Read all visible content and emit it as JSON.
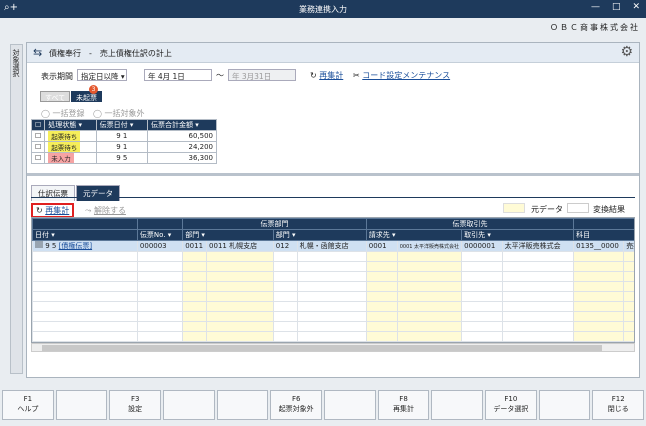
{
  "window": {
    "title": "業務連携入力",
    "company": "ＯＢＣ商事株式会社"
  },
  "side_tab": "対象選択",
  "header": {
    "title": "債権奉行　-　売上債権仕訳の計上"
  },
  "filter": {
    "label": "表示期間",
    "mode": "指定日以降",
    "date_from": "年  4月  1日",
    "tilde": "～",
    "date_to": "年  3月31日",
    "recalc": "再集計",
    "code_settings": "コード設定メンテナンス"
  },
  "status_buttons": {
    "all": "すべて",
    "unstarted": "未起票",
    "count": "3"
  },
  "options": {
    "batch": "一括登録",
    "batch_exclude": "一括対象外"
  },
  "summary_table": {
    "headers": [
      "処理状態",
      "伝票日付",
      "伝票合計金額"
    ],
    "rows": [
      {
        "status": "起票待ち",
        "date": "9  1",
        "amount": "60,500"
      },
      {
        "status": "起票待ち",
        "date": "9  1",
        "amount": "24,200"
      },
      {
        "status": "未入力",
        "date": "9  5",
        "amount": "36,300"
      }
    ]
  },
  "tabs": [
    "仕訳伝票",
    "元データ"
  ],
  "toolbar": {
    "recalc": "再集計",
    "release": "解除する",
    "legend_source": "元データ",
    "legend_converted": "変換結果"
  },
  "grid": {
    "group_headers": [
      "伝票部門",
      "伝票取引先"
    ],
    "headers": [
      "日付",
      "伝票No.",
      "部門",
      "部門",
      "請求先",
      "取引先",
      "科目"
    ],
    "row": {
      "date": "9  5",
      "link": "[債権伝票]",
      "no": "000003",
      "dept_code": "0011",
      "dept_name": "0011 札幌支店",
      "dept2_code": "012",
      "dept2_name": "札幌・函館支店",
      "bill_code": "0001",
      "bill_name": "0001 太平洋販売株式会社",
      "cust_code": "0000001",
      "cust_name": "太平洋販売株式会",
      "acct_code": "0135__0000",
      "acct_name": "売掛金"
    }
  },
  "fkeys": [
    {
      "key": "F1",
      "label": "ヘルプ"
    },
    {
      "key": "",
      "label": ""
    },
    {
      "key": "F3",
      "label": "設定"
    },
    {
      "key": "",
      "label": ""
    },
    {
      "key": "",
      "label": ""
    },
    {
      "key": "F6",
      "label": "起票対象外"
    },
    {
      "key": "",
      "label": ""
    },
    {
      "key": "F8",
      "label": "再集計"
    },
    {
      "key": "",
      "label": ""
    },
    {
      "key": "F10",
      "label": "データ選択"
    },
    {
      "key": "",
      "label": ""
    },
    {
      "key": "F12",
      "label": "閉じる"
    }
  ]
}
